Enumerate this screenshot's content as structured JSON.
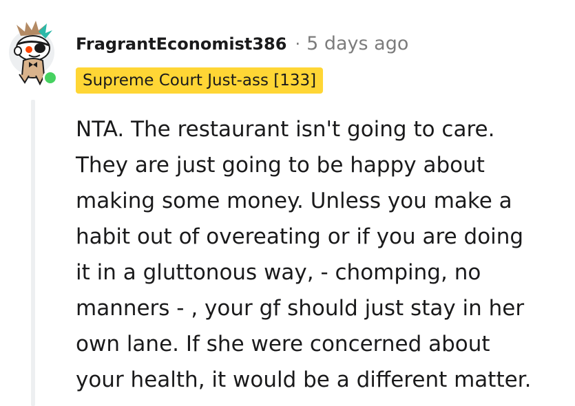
{
  "comment": {
    "author": "FragrantEconomist386",
    "separator": "·",
    "timestamp": "5 days ago",
    "flair": "Supreme Court Just-ass [133]",
    "online_color": "#46d160",
    "flair_color": "#ffd635",
    "avatar_icon": "snoo-avatar-icon",
    "body_lines": [
      "NTA. The restaurant isn't going to care.",
      "They are just going to be happy about",
      "making some money. Unless you make a",
      "habit out of overeating or if you are doing",
      "it in a gluttonous way, - chomping, no",
      "manners - , your gf should just stay in her",
      "own lane. If she were concerned about",
      "your health, it would be a different matter."
    ]
  }
}
